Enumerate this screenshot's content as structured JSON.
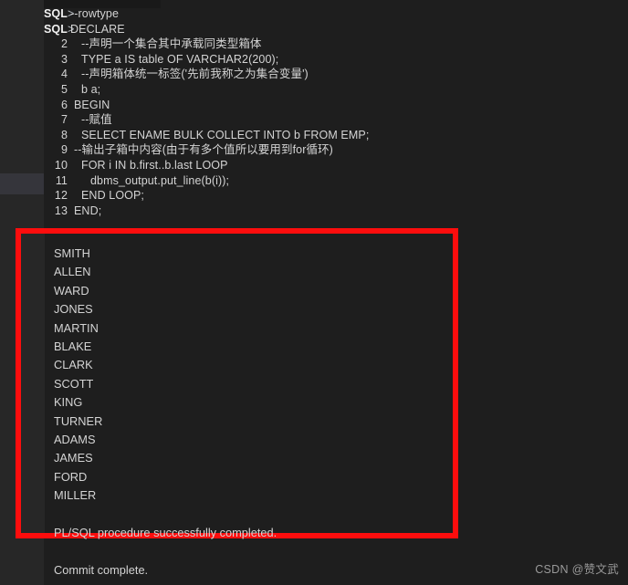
{
  "console": {
    "prompt_label": "SQL",
    "prompt_symbol": ">",
    "lines": [
      {
        "gutter": "SQL>",
        "type": "prompt",
        "text": "--rowtype"
      },
      {
        "gutter": "SQL>",
        "type": "prompt",
        "text": "DECLARE"
      },
      {
        "gutter": "2",
        "type": "num",
        "text": "--声明一个集合其中承载同类型箱体"
      },
      {
        "gutter": "3",
        "type": "num",
        "text": "TYPE a IS table OF VARCHAR2(200);"
      },
      {
        "gutter": "4",
        "type": "num",
        "text": "--声明箱体统一标签('先前我称之为集合变量')"
      },
      {
        "gutter": "5",
        "type": "num",
        "text": "b a;"
      },
      {
        "gutter": "6",
        "type": "num",
        "text": "BEGIN"
      },
      {
        "gutter": "7",
        "type": "num",
        "text": "--赋值"
      },
      {
        "gutter": "8",
        "type": "num",
        "text": "SELECT ENAME BULK COLLECT INTO b FROM EMP;"
      },
      {
        "gutter": "9",
        "type": "num",
        "text": "--输出子箱中内容(由于有多个值所以要用到for循环)"
      },
      {
        "gutter": "10",
        "type": "num",
        "text": "FOR i IN b.first..b.last LOOP"
      },
      {
        "gutter": "11",
        "type": "num",
        "text": "dbms_output.put_line(b(i));"
      },
      {
        "gutter": "12",
        "type": "num",
        "text": "END LOOP;"
      },
      {
        "gutter": "13",
        "type": "num",
        "text": "END;"
      }
    ]
  },
  "output": {
    "rows": [
      "SMITH",
      "ALLEN",
      "WARD",
      "JONES",
      "MARTIN",
      "BLAKE",
      "CLARK",
      "SCOTT",
      "KING",
      "TURNER",
      "ADAMS",
      "JAMES",
      "FORD",
      "MILLER"
    ],
    "status_procedure": "PL/SQL procedure successfully completed.",
    "status_commit": "Commit complete.",
    "highlight_color": "#fc0d0d"
  },
  "watermark": {
    "text": "CSDN @赞文武"
  },
  "theme": {
    "background": "#1e1e1e",
    "gutter_background": "#272727",
    "text_color": "#d4d4d4",
    "accent": "#fc0d0d"
  }
}
